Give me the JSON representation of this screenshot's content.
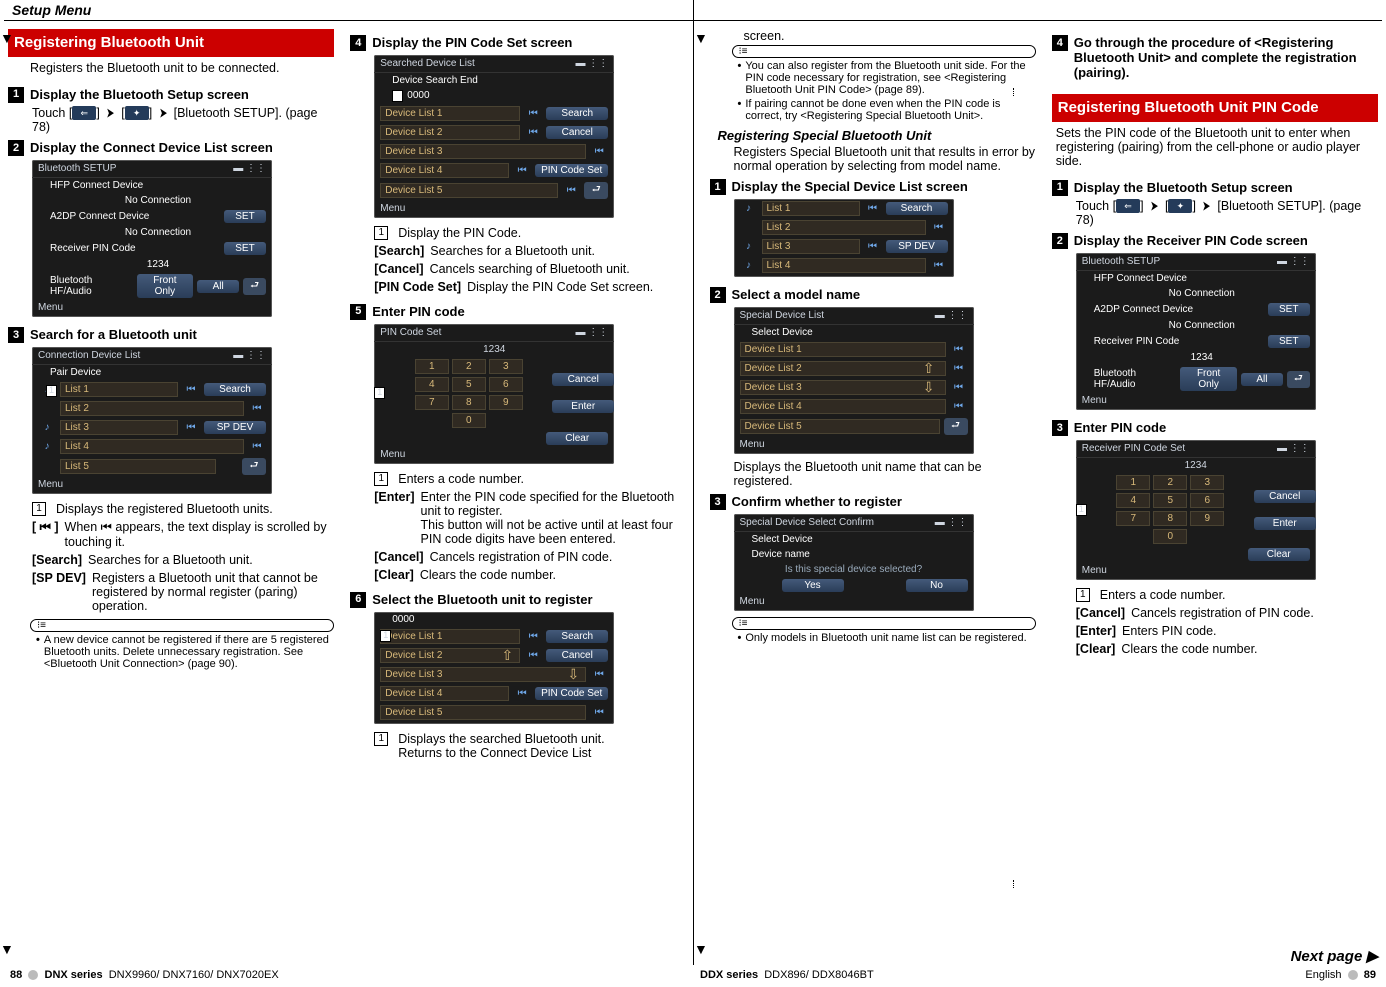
{
  "header": {
    "title": "Setup Menu"
  },
  "col1": {
    "section_title": "Registering Bluetooth Unit",
    "section_desc": "Registers the Bluetooth unit to be connected.",
    "s1": {
      "title": "Display the Bluetooth Setup screen",
      "body_before": "Touch [",
      "body_mid": "] ",
      "body_mid2": " [",
      "body_after": "] ",
      "body_end": " [Bluetooth SETUP]. (page 78)"
    },
    "s2": {
      "title": "Display the Connect Device List screen"
    },
    "shot_bt": {
      "title": "Bluetooth SETUP",
      "r1": "HFP Connect Device",
      "r1v": "No Connection",
      "r2": "A2DP Connect Device",
      "r2v": "No Connection",
      "r3": "Receiver PIN Code",
      "r3v": "1234",
      "r4": "Bluetooth HF/Audio",
      "r4b1": "Front Only",
      "r4b2": "All",
      "set": "SET",
      "menu": "Menu"
    },
    "s3": {
      "title": "Search for a Bluetooth unit"
    },
    "shot_conn": {
      "title": "Connection Device List",
      "sub": "Pair Device",
      "l1": "List 1",
      "l2": "List 2",
      "l3": "List 3",
      "l4": "List 4",
      "l5": "List 5",
      "search": "Search",
      "spdev": "SP DEV",
      "menu": "Menu"
    },
    "defs": {
      "d1": "Displays the registered Bluetooth units.",
      "d_icon_key": "[ ⏮ ]",
      "d_icon": "When ⏮ appears, the text display is scrolled by touching it.",
      "search_k": "[Search]",
      "search_v": "Searches for a Bluetooth unit.",
      "spdev_k": "[SP DEV]",
      "spdev_v": "Registers a Bluetooth unit that cannot be registered by normal register (paring) operation."
    },
    "note": "A new device cannot be registered if there are 5 registered Bluetooth units. Delete unnecessary registration.  See <Bluetooth Unit Connection> (page 90)."
  },
  "col2": {
    "s4": {
      "title": "Display the PIN Code Set screen"
    },
    "shot_sd": {
      "title": "Searched Device List",
      "sub": "Device Search End",
      "sub2": "0000",
      "l1": "Device List 1",
      "l2": "Device List 2",
      "l3": "Device List 3",
      "l4": "Device List 4",
      "l5": "Device List 5",
      "search": "Search",
      "cancel": "Cancel",
      "pin": "PIN Code Set",
      "menu": "Menu"
    },
    "defs4": {
      "d1": "Display the PIN Code.",
      "s_k": "[Search]",
      "s_v": "Searches for a Bluetooth unit.",
      "c_k": "[Cancel]",
      "c_v": "Cancels searching of Bluetooth unit.",
      "p_k": "[PIN Code Set]",
      "p_v": "Display the PIN Code Set screen."
    },
    "s5": {
      "title": "Enter PIN code"
    },
    "shot_pin": {
      "title": "PIN Code Set",
      "val": "1234",
      "cancel": "Cancel",
      "enter": "Enter",
      "clear": "Clear",
      "menu": "Menu"
    },
    "defs5": {
      "d1": "Enters a code number.",
      "e_k": "[Enter]",
      "e_v": "Enter the PIN code specified for the Bluetooth unit to register.",
      "e_v2": "This button will not be active until at least four PIN code digits have been entered.",
      "c_k": "[Cancel]",
      "c_v": "Cancels registration of PIN code.",
      "cl_k": "[Clear]",
      "cl_v": "Clears the code number."
    },
    "s6": {
      "title": "Select the Bluetooth unit to register"
    },
    "shot_sel": {
      "sub": "0000",
      "l1": "Device List 1",
      "l2": "Device List 2",
      "l3": "Device List 3",
      "l4": "Device List 4",
      "l5": "Device List 5",
      "search": "Search",
      "cancel": "Cancel",
      "pin": "PIN Code Set",
      "menu": "Menu"
    },
    "defs6": {
      "d1": "Displays the searched Bluetooth unit.",
      "d2": "Returns to the Connect Device List"
    }
  },
  "col3": {
    "top": "screen.",
    "note1": "You can also register from the Bluetooth unit side. For the PIN code necessary for registration, see <Registering Bluetooth Unit PIN Code> (page 89).",
    "note2": "If pairing cannot be done even when the PIN code is correct, try <Registering Special Bluetooth Unit>.",
    "sub_heading": "Registering Special Bluetooth Unit",
    "sub_desc": "Registers Special Bluetooth unit that results in error by normal operation by selecting from model name.",
    "s1": {
      "title": "Display the Special Device List screen"
    },
    "shot_sp": {
      "l1": "List 1",
      "l2": "List 2",
      "l3": "List 3",
      "l4": "List 4",
      "search": "Search",
      "spdev": "SP DEV"
    },
    "s2": {
      "title": "Select a model name"
    },
    "shot_spd": {
      "title": "Special Device List",
      "sub": "Select Device",
      "l1": "Device List 1",
      "l2": "Device List 2",
      "l3": "Device List 3",
      "l4": "Device List 4",
      "l5": "Device List 5",
      "menu": "Menu"
    },
    "desc2": "Displays the Bluetooth unit name that can be registered.",
    "s3": {
      "title": "Confirm whether to register"
    },
    "shot_conf": {
      "title": "Special Device Select Confirm",
      "sub": "Select Device",
      "sub2": "Device name",
      "msg": "Is this special device selected?",
      "yes": "Yes",
      "no": "No",
      "menu": "Menu"
    },
    "note3": "Only models in Bluetooth unit name list can be registered."
  },
  "col4": {
    "s4": {
      "title": "Go through the procedure of <Registering Bluetooth Unit> and complete the registration (pairing)."
    },
    "section_title": "Registering Bluetooth Unit PIN Code",
    "section_desc": "Sets the PIN code of the Bluetooth unit to enter when registering (pairing) from the cell-phone or audio player side.",
    "s1": {
      "title": "Display the Bluetooth Setup screen",
      "body": "Touch [",
      "body2": "] ",
      " body3": " [",
      "body4": "] ",
      "body5": " [Bluetooth SETUP]. (page 78)"
    },
    "s2": {
      "title": "Display the Receiver PIN Code screen"
    },
    "shot_bt": {
      "title": "Bluetooth SETUP",
      "r1": "HFP Connect Device",
      "r1v": "No Connection",
      "r2": "A2DP Connect Device",
      "r2v": "No Connection",
      "r3": "Receiver PIN Code",
      "r3v": "1234",
      "r4": "Bluetooth HF/Audio",
      "r4b1": "Front Only",
      "r4b2": "All",
      "set": "SET",
      "menu": "Menu"
    },
    "s3": {
      "title": "Enter PIN code"
    },
    "shot_pin": {
      "title": "Receiver PIN Code Set",
      "val": "1234",
      "cancel": "Cancel",
      "enter": "Enter",
      "clear": "Clear",
      "menu": "Menu"
    },
    "defs": {
      "d1": "Enters a code number.",
      "c_k": "[Cancel]",
      "c_v": "Cancels registration of PIN code.",
      "e_k": "[Enter]",
      "e_v": "Enters PIN code.",
      "cl_k": "[Clear]",
      "cl_v": "Clears the code number."
    },
    "next": "Next page ▶"
  },
  "footer": {
    "left_pg": "88",
    "left_series": "DNX series",
    "left_models": "DNX9960/ DNX7160/ DNX7020EX",
    "right_series": "DDX series",
    "right_models": "DDX896/ DDX8046BT",
    "lang": "English",
    "right_pg": "89"
  }
}
